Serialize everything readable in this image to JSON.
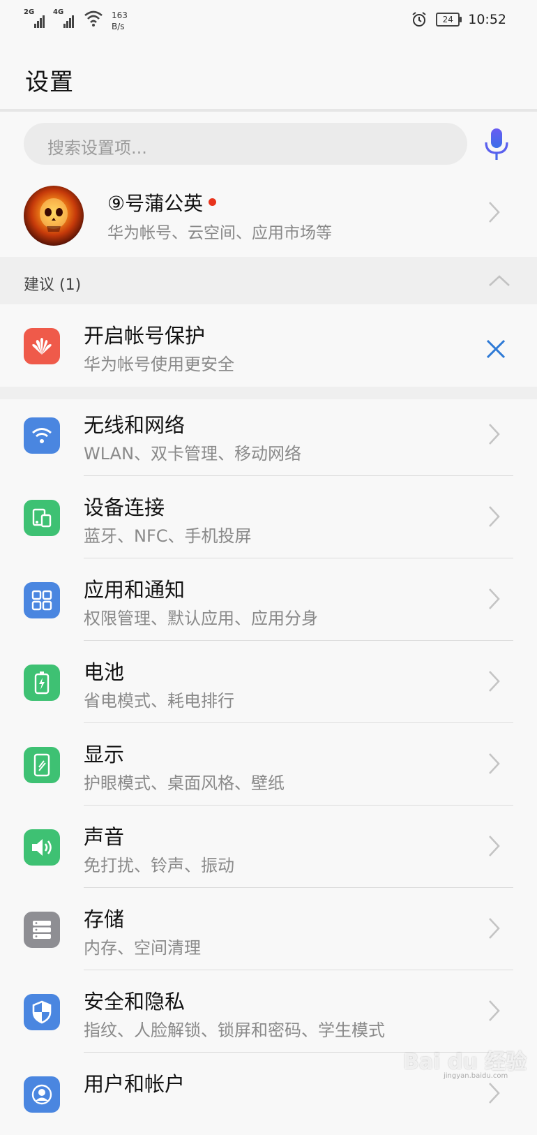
{
  "status": {
    "sig1": "2G",
    "sig2": "4G",
    "speed_value": "163",
    "speed_unit": "B/s",
    "battery": "24",
    "time": "10:52"
  },
  "header": {
    "title": "设置"
  },
  "search": {
    "placeholder": "搜索设置项..."
  },
  "account": {
    "name": "⑨号蒲公英",
    "subtitle": "华为帐号、云空间、应用市场等"
  },
  "suggestions": {
    "label": "建议 (1)",
    "item": {
      "title": "开启帐号保护",
      "subtitle": "华为帐号使用更安全"
    }
  },
  "settings": [
    {
      "title": "无线和网络",
      "subtitle": "WLAN、双卡管理、移动网络",
      "icon": "wifi-icon",
      "color": "#4a86e0"
    },
    {
      "title": "设备连接",
      "subtitle": "蓝牙、NFC、手机投屏",
      "icon": "device-connect-icon",
      "color": "#3ec173"
    },
    {
      "title": "应用和通知",
      "subtitle": "权限管理、默认应用、应用分身",
      "icon": "apps-grid-icon",
      "color": "#4a86e0"
    },
    {
      "title": "电池",
      "subtitle": "省电模式、耗电排行",
      "icon": "battery-icon",
      "color": "#3ec173"
    },
    {
      "title": "显示",
      "subtitle": "护眼模式、桌面风格、壁纸",
      "icon": "display-icon",
      "color": "#3ec173"
    },
    {
      "title": "声音",
      "subtitle": "免打扰、铃声、振动",
      "icon": "speaker-icon",
      "color": "#3ec173"
    },
    {
      "title": "存储",
      "subtitle": "内存、空间清理",
      "icon": "storage-icon",
      "color": "#8e8e93"
    },
    {
      "title": "安全和隐私",
      "subtitle": "指纹、人脸解锁、锁屏和密码、学生模式",
      "icon": "shield-icon",
      "color": "#4a86e0"
    },
    {
      "title": "用户和帐户",
      "subtitle": "",
      "icon": "user-icon",
      "color": "#4a86e0"
    }
  ],
  "watermark": {
    "text": "Bai du 经验",
    "url": "jingyan.baidu.com"
  }
}
